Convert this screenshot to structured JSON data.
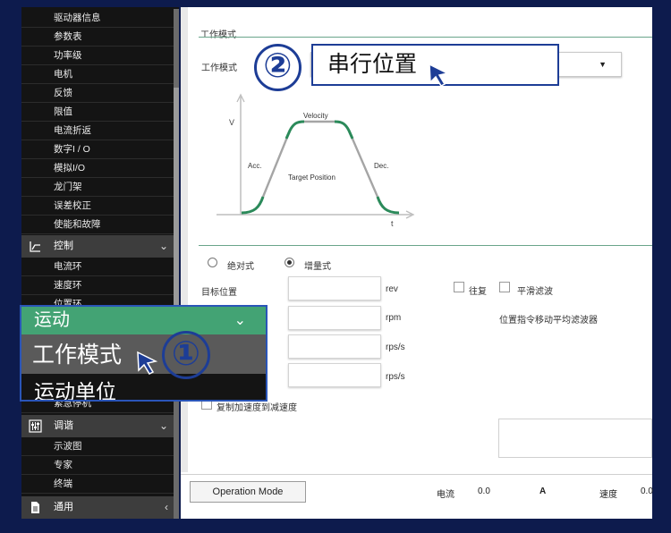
{
  "sidebar": {
    "items_top": [
      "驱动器信息",
      "参数表",
      "功率级",
      "电机",
      "反馈",
      "限值",
      "电流折返",
      "数字I / O",
      "模拟I/O",
      "龙门架",
      "误差校正",
      "使能和故障"
    ],
    "section_control": {
      "label": "控制",
      "icon": "control-chart-icon"
    },
    "items_control": [
      "电流环",
      "速度环",
      "位置环"
    ],
    "items_motion": [
      "紧急停机"
    ],
    "section_tuning": {
      "label": "调谐",
      "icon": "sliders-icon"
    },
    "items_tuning": [
      "示波图",
      "专家",
      "终端"
    ],
    "section_general": {
      "label": "通用",
      "icon": "document-icon"
    }
  },
  "main": {
    "group_title": "工作模式",
    "mode_label": "工作模式",
    "profile": {
      "v_label": "V",
      "t_label": "t",
      "velocity": "Velocity",
      "acc": "Acc.",
      "dec": "Dec.",
      "target": "Target Position"
    },
    "radio_absolute": "绝对式",
    "radio_incremental": "增量式",
    "target_position_label": "目标位置",
    "unit_rev": "rev",
    "unit_rpm": "rpm",
    "unit_rps_s_1": "rps/s",
    "unit_rps_s_2": "rps/s",
    "reciprocate": "往复",
    "smooth_filter": "平滑滤波",
    "filter_desc": "位置指令移动平均滤波器",
    "copy_acc": "复制加速度到减速度"
  },
  "statusbar": {
    "op_mode_button": "Operation Mode",
    "current_label": "电流",
    "current_value": "0.0",
    "current_unit": "A",
    "speed_label": "速度",
    "speed_value": "0.0"
  },
  "callouts": {
    "menu_header": "运动",
    "menu_selected": "工作模式",
    "menu_next": "运动单位",
    "badge1": "①",
    "badge2": "②",
    "selected_mode": "串行位置"
  },
  "colors": {
    "background": "#0d1b4d",
    "accent_green": "#43a374",
    "callout_blue": "#1d3d96"
  }
}
